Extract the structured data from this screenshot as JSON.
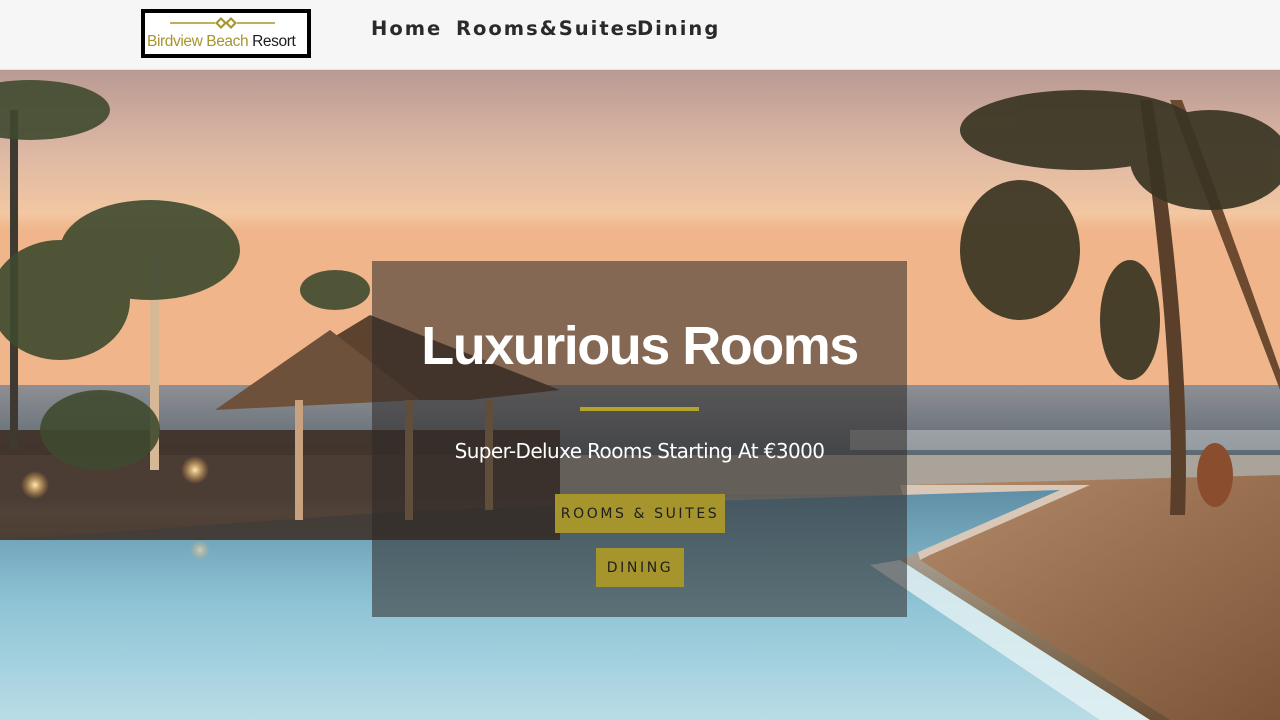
{
  "header": {
    "logo": {
      "text_gold": "Birdview Beach",
      "text_dark": " Resort"
    },
    "nav": [
      "Home",
      "Rooms&Suites",
      "Dining"
    ]
  },
  "hero": {
    "title": "Luxurious Rooms",
    "subtitle": "Super-Deluxe Rooms Starting At €3000",
    "buttons": [
      "ROOMS & SUITES",
      "DINING"
    ]
  },
  "colors": {
    "accent_gold": "#a6952c",
    "header_bg": "#f6f6f6",
    "overlay": "rgba(45,40,38,0.55)"
  }
}
